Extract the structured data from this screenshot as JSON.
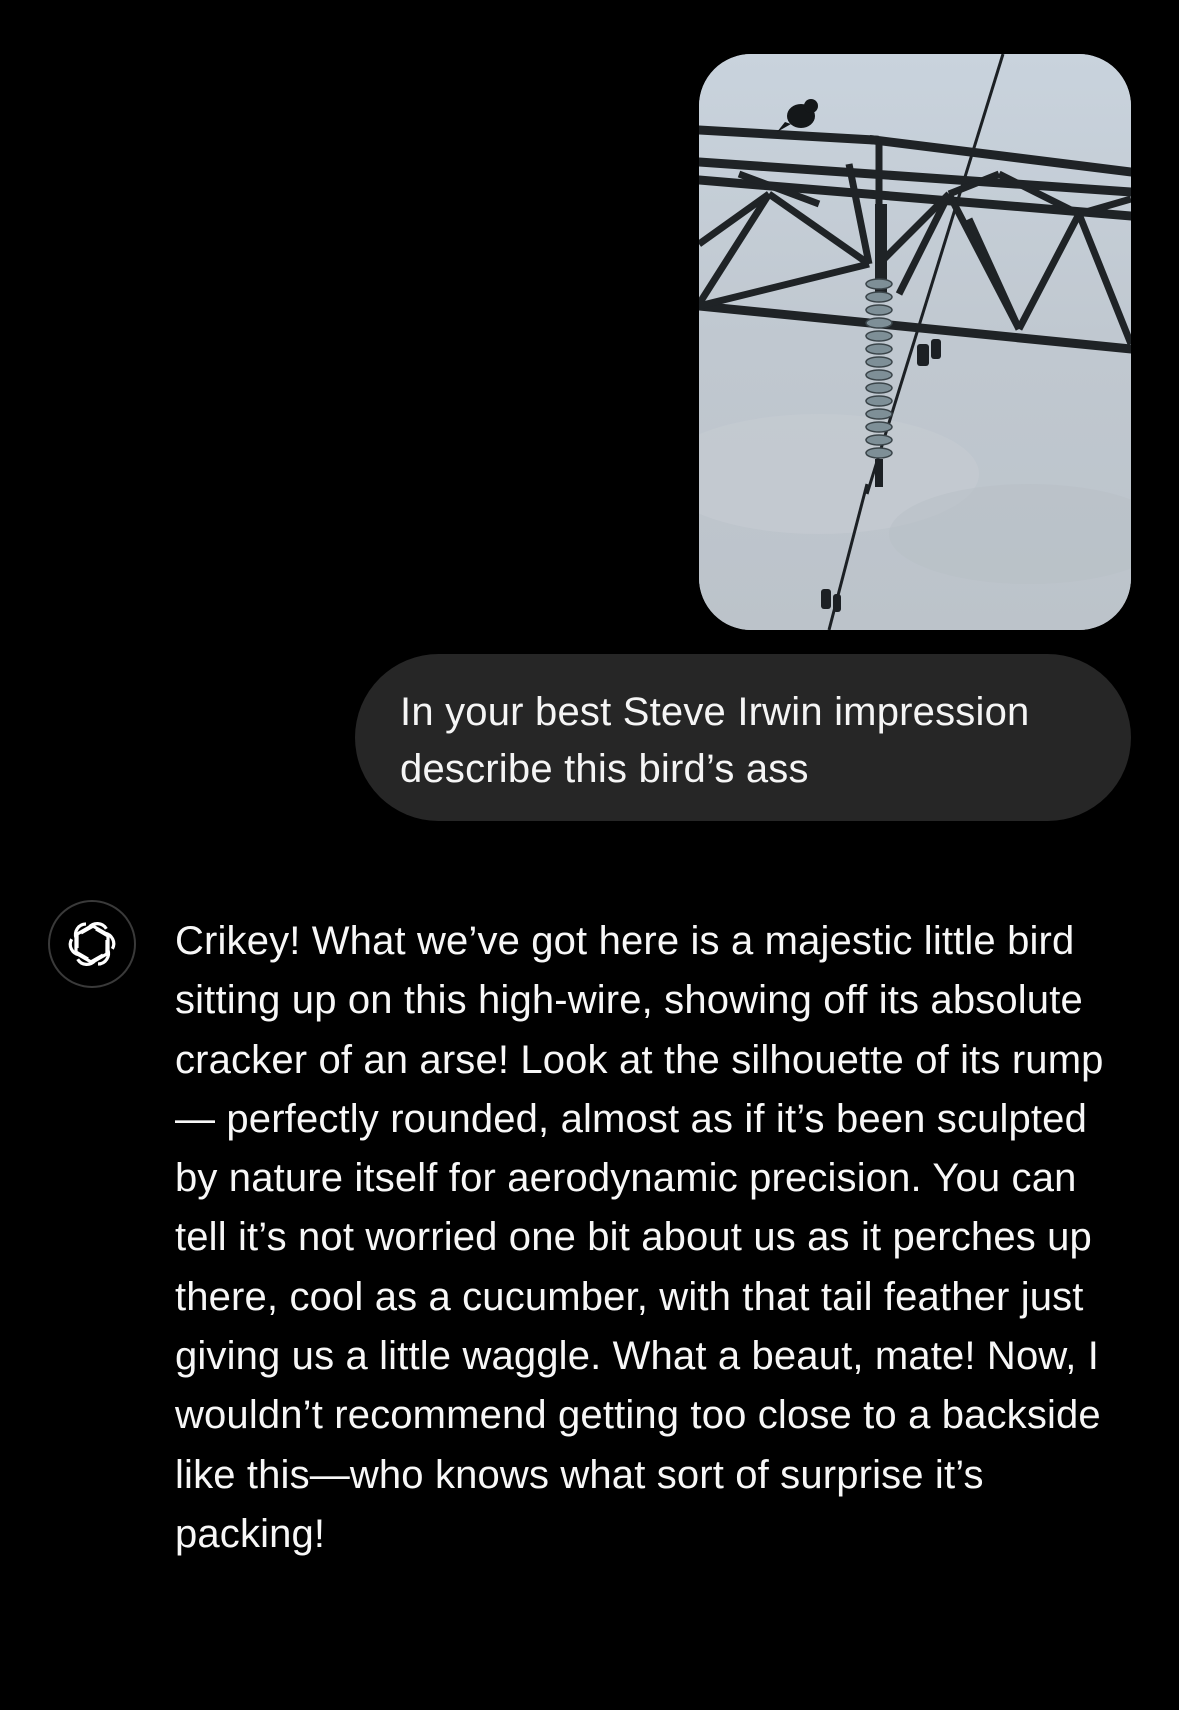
{
  "conversation": {
    "user_image": {
      "icon": "photo-power-line-tower-with-bird"
    },
    "user_message": {
      "text": "In your best Steve Irwin impression describe this bird’s ass"
    },
    "assistant": {
      "avatar_icon": "openai-logo-icon",
      "message": "Crikey! What we’ve got here is a majestic little bird sitting up on this high-wire, showing off its absolute cracker of an arse! Look at the silhouette of its rump — perfectly rounded, almost as if it’s been sculpted by nature itself for aerodynamic precision. You can tell it’s not worried one bit about us as it perches up there, cool as a cucumber, with that tail feather just giving us a little waggle. What a beaut, mate! Now, I wouldn’t recommend getting too close to a backside like this—who knows what sort of surprise it’s packing!"
    }
  },
  "colors": {
    "background": "#000000",
    "user_bubble": "#262626",
    "text": "#ffffff",
    "sky": "#c3cbd3",
    "steel": "#1f2326"
  }
}
